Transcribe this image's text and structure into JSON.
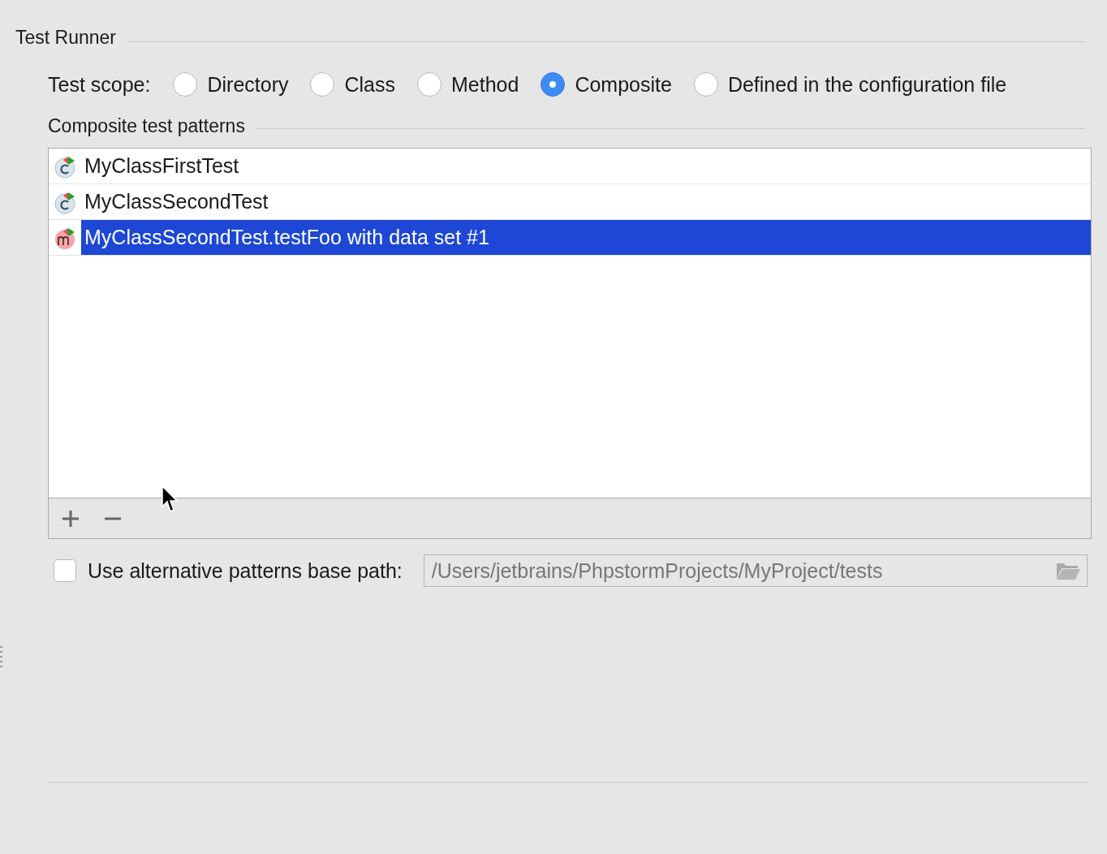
{
  "section_title": "Test Runner",
  "scope": {
    "label": "Test scope:",
    "options": [
      {
        "label": "Directory",
        "selected": false
      },
      {
        "label": "Class",
        "selected": false
      },
      {
        "label": "Method",
        "selected": false
      },
      {
        "label": "Composite",
        "selected": true
      },
      {
        "label": "Defined in the configuration file",
        "selected": false
      }
    ]
  },
  "patterns": {
    "title": "Composite test patterns",
    "items": [
      {
        "kind": "class",
        "label": "MyClassFirstTest",
        "selected": false
      },
      {
        "kind": "class",
        "label": "MyClassSecondTest",
        "selected": false
      },
      {
        "kind": "method",
        "label": "MyClassSecondTest.testFoo with data set #1",
        "selected": true
      }
    ]
  },
  "base_path": {
    "label": "Use alternative patterns base path:",
    "checked": false,
    "value": "/Users/jetbrains/PhpstormProjects/MyProject/tests"
  }
}
